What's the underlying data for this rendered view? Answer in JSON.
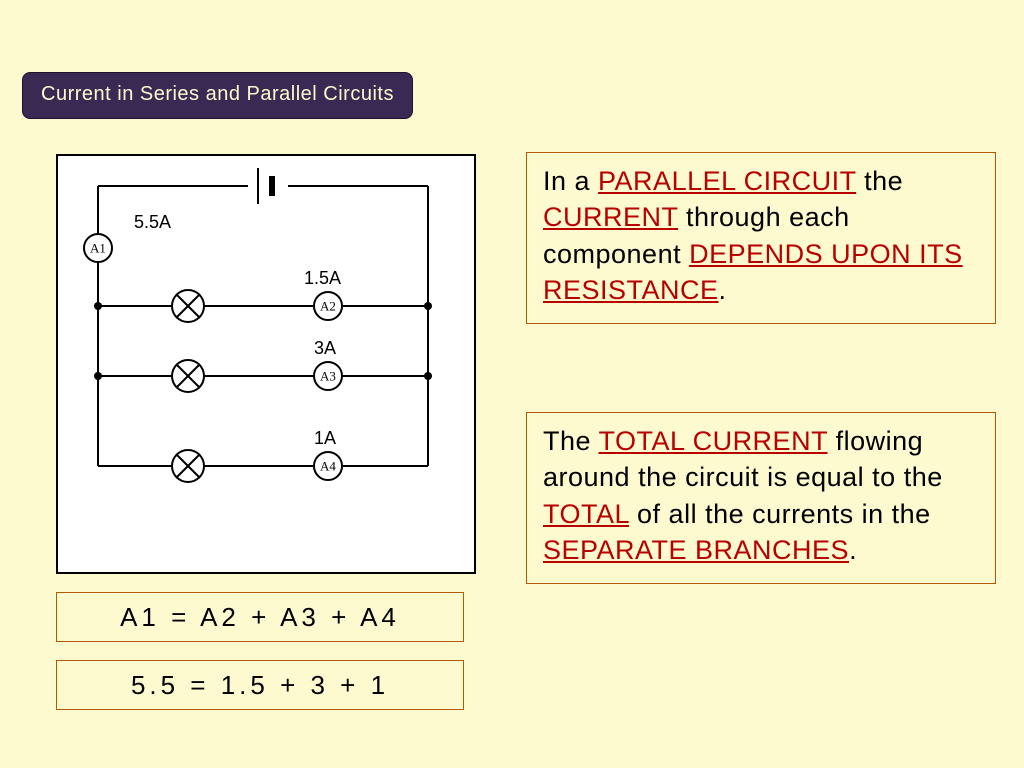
{
  "title": "Current in Series and Parallel Circuits",
  "circuit": {
    "ammeters": [
      {
        "id": "A1",
        "reading": "5.5A"
      },
      {
        "id": "A2",
        "reading": "1.5A"
      },
      {
        "id": "A3",
        "reading": "3A"
      },
      {
        "id": "A4",
        "reading": "1A"
      }
    ]
  },
  "formula": "A1  =  A2  +  A3  +  A4",
  "calculation": "5.5  =  1.5  +  3  +  1",
  "panel1": {
    "t1": "In a ",
    "k1": "parallel circuit",
    "t2": " the ",
    "k2": "current",
    "t3": " through each component ",
    "k3": "depends upon its resistance",
    "t4": "."
  },
  "panel2": {
    "t1": "The ",
    "k1": "total current",
    "t2": " flowing around the circuit is equal to the ",
    "k2": "total",
    "t3": " of all the currents in the ",
    "k3": "separate branches",
    "t4": "."
  }
}
